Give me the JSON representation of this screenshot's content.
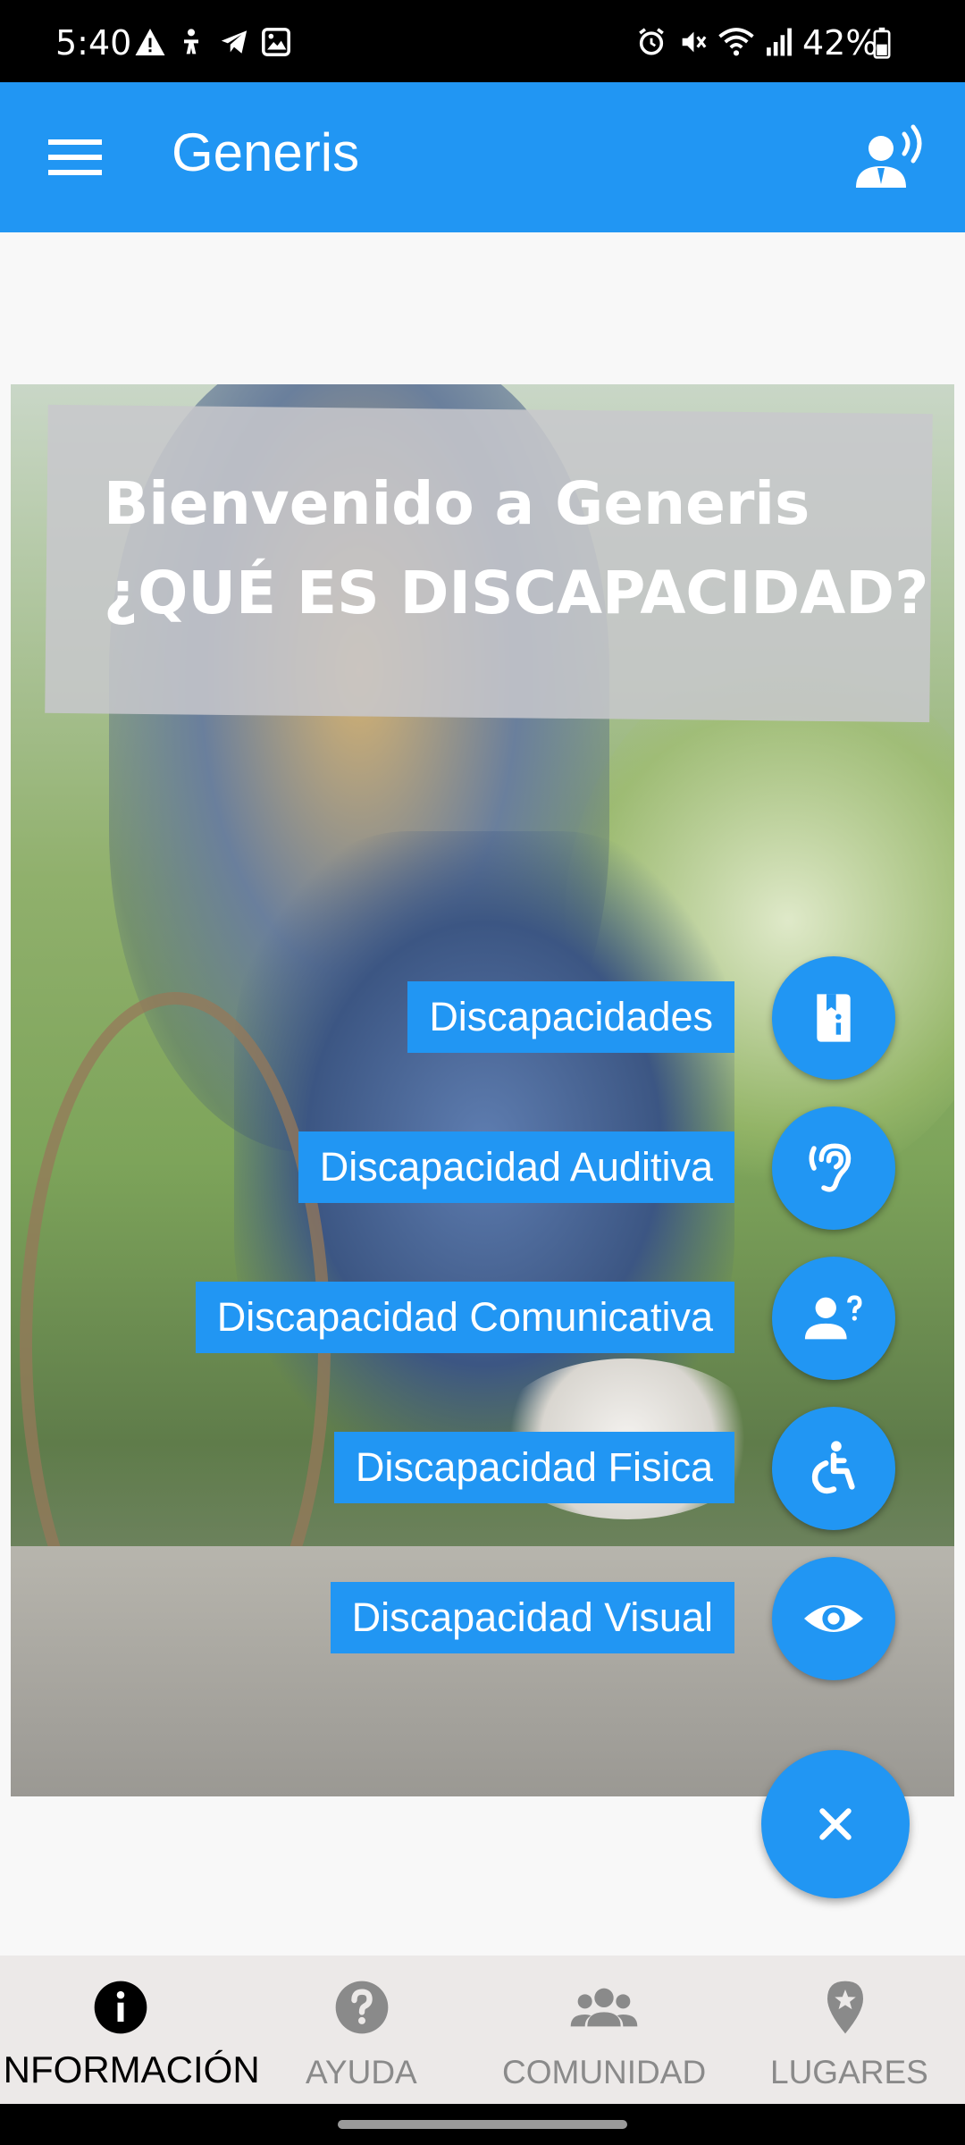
{
  "status_bar": {
    "time": "5:40",
    "battery": "42%"
  },
  "app_bar": {
    "title": "Generis"
  },
  "hero": {
    "line1": "Bienvenido a Generis",
    "line2": "¿QUÉ ES DISCAPACIDAD?"
  },
  "fab_menu": {
    "items": [
      {
        "label": "Discapacidades",
        "icon": "book-info-icon"
      },
      {
        "label": "Discapacidad Auditiva",
        "icon": "ear-icon"
      },
      {
        "label": "Discapacidad Comunicativa",
        "icon": "person-question-icon"
      },
      {
        "label": "Discapacidad Fisica",
        "icon": "wheelchair-icon"
      },
      {
        "label": "Discapacidad Visual",
        "icon": "eye-icon"
      }
    ],
    "close_icon": "close-icon"
  },
  "bottom_nav": {
    "items": [
      {
        "label": "INFORMACIÓN",
        "icon": "info-icon",
        "active": true
      },
      {
        "label": "AYUDA",
        "icon": "help-icon",
        "active": false
      },
      {
        "label": "COMUNIDAD",
        "icon": "group-icon",
        "active": false
      },
      {
        "label": "LUGARES",
        "icon": "place-icon",
        "active": false
      }
    ]
  },
  "colors": {
    "primary": "#2196f3",
    "nav_background": "#ece9e8",
    "nav_active": "#000000",
    "nav_inactive": "#8a8a8a"
  }
}
